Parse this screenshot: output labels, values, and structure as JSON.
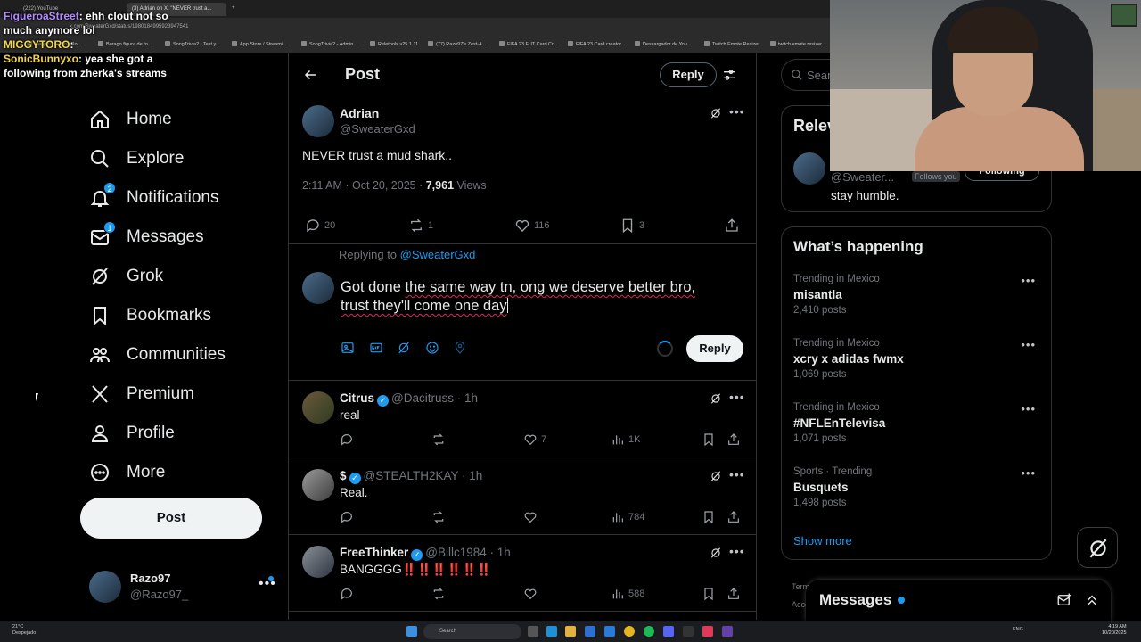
{
  "browser": {
    "tabs": [
      "(222) YouTube",
      "(3) Adrian on X: \"NEVER trust a...",
      "+"
    ],
    "url": "x.com/SweaterGxd/status/1980184995923947541",
    "bookmarks": [
      "Happy Cristiano Ro...",
      "Burago figura de to...",
      "SongTrivia2 - Test y...",
      "App Store / Streami...",
      "SongTrivia2 - Admin...",
      "Reletools v25.1.11",
      "(77) Razo97's Zest-A...",
      "FIFA 23 FUT Card Cr...",
      "FIFA 23 Card creator...",
      "Descargador de You...",
      "Twitch Emote Resizer",
      "twitch emote resizer..."
    ]
  },
  "chat": {
    "lines": [
      {
        "user": "FigueroaStreet",
        "text": ": ehh clout not so"
      },
      {
        "user": "",
        "text": "much anymore lol"
      },
      {
        "user": "MIGGYTORO",
        "text": ":"
      },
      {
        "user": "SonicBunnyxo",
        "text": ": yea she got a"
      },
      {
        "user": "",
        "text": "following from zherka's streams"
      }
    ]
  },
  "nav": {
    "items": [
      {
        "label": "Home",
        "icon": "home-icon"
      },
      {
        "label": "Explore",
        "icon": "search-icon"
      },
      {
        "label": "Notifications",
        "icon": "bell-icon",
        "badge": "2"
      },
      {
        "label": "Messages",
        "icon": "mail-icon",
        "badge": "1"
      },
      {
        "label": "Grok",
        "icon": "grok-icon"
      },
      {
        "label": "Bookmarks",
        "icon": "bookmark-icon"
      },
      {
        "label": "Communities",
        "icon": "communities-icon"
      },
      {
        "label": "Premium",
        "icon": "x-logo-icon"
      },
      {
        "label": "Profile",
        "icon": "person-icon"
      },
      {
        "label": "More",
        "icon": "more-circle-icon"
      }
    ],
    "post_label": "Post",
    "account": {
      "name": "Razo97",
      "handle": "@Razo97_",
      "more": "•••"
    }
  },
  "post": {
    "header_title": "Post",
    "header_reply": "Reply",
    "author": "Adrian",
    "handle": "@SweaterGxd",
    "text": "NEVER trust a mud shark..",
    "time": "2:11 AM · Oct 20, 2025 · ",
    "views": "7,961",
    "views_label": " Views",
    "replies": "20",
    "reposts": "1",
    "likes": "116",
    "bookmarks": "3"
  },
  "compose": {
    "replying_to_label": "Replying to ",
    "replying_to_handle": "@SweaterGxd",
    "text_line1_a": "Got done ",
    "text_line1_b": "the same way tn, ong we deserve better bro,",
    "text_line2": "trust they'll come one day",
    "reply_label": "Reply"
  },
  "replies": [
    {
      "name": "Citrus",
      "handle": "@Dacitruss",
      "time": "· 1h",
      "text": "real",
      "likes": "7",
      "views": "1K"
    },
    {
      "name": "$",
      "handle": "@STEALTH2KAY",
      "time": "· 1h",
      "text": "Real.",
      "likes": "",
      "views": "784"
    },
    {
      "name": "FreeThinker",
      "handle": "@Billc1984",
      "time": "· 1h",
      "text": "BANGGGG",
      "emoji": "‼️‼️‼️‼️‼️‼️",
      "likes": "",
      "views": "588"
    }
  ],
  "right": {
    "search_placeholder": "Search",
    "relevant_title": "Relevant people",
    "relevant_handle": "@Sweater...",
    "follows_you": "Follows you",
    "following": "Following",
    "relevant_bio": "stay humble.",
    "happening_title": "What’s happening",
    "trends": [
      {
        "context": "Trending in Mexico",
        "name": "misantla",
        "count": "2,410 posts"
      },
      {
        "context": "Trending in Mexico",
        "name": "xcry x adidas fwmx",
        "count": "1,069 posts"
      },
      {
        "context": "Trending in Mexico",
        "name": "#NFLEnTelevisa",
        "count": "1,071 posts"
      },
      {
        "context": "Sports · Trending",
        "name": "Busquets",
        "count": "1,498 posts"
      }
    ],
    "show_more": "Show more",
    "footer_line1": "Terms",
    "footer_line2": "Acce",
    "messages_title": "Messages"
  },
  "taskbar": {
    "weather_temp": "21°C",
    "weather_desc": "Despejado",
    "search_label": "Search",
    "lang": "ENG",
    "time": "4:19 AM",
    "date": "10/20/2025"
  }
}
